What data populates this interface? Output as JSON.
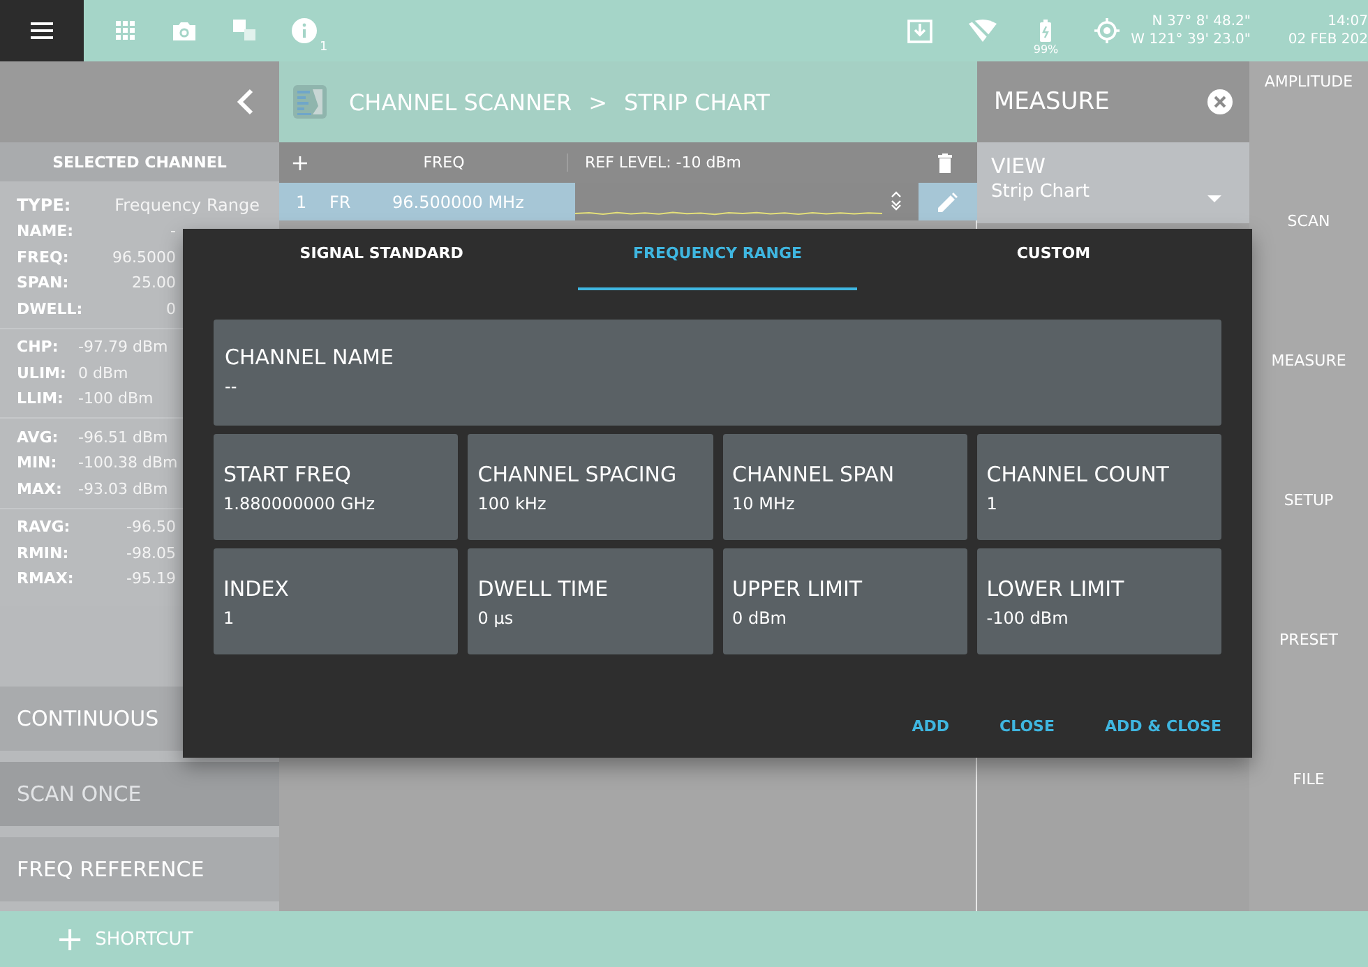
{
  "status_bar": {
    "info_count": "1",
    "battery": "99%",
    "latitude": "N 37° 8' 48.2\"",
    "longitude": "W 121° 39' 23.0\"",
    "time": "14:07",
    "date": "02 FEB 202"
  },
  "left_panel": {
    "header": "SELECTED CHANNEL",
    "groups": [
      {
        "rows": [
          {
            "label": "TYPE:",
            "value": "Frequency Range"
          },
          {
            "label": "NAME:",
            "value": "-"
          },
          {
            "label": "FREQ:",
            "value": "96.5000"
          },
          {
            "label": "SPAN:",
            "value": "25.00"
          },
          {
            "label": "DWELL:",
            "value": "0"
          }
        ]
      },
      {
        "rows": [
          {
            "label": "CHP:",
            "value": "-97.79 dBm"
          },
          {
            "label": "ULIM:",
            "value": "0 dBm"
          },
          {
            "label": "LLIM:",
            "value": "-100 dBm"
          }
        ]
      },
      {
        "rows": [
          {
            "label": "AVG:",
            "value": "-96.51 dBm"
          },
          {
            "label": "MIN:",
            "value": "-100.38 dBm"
          },
          {
            "label": "MAX:",
            "value": "-93.03 dBm"
          }
        ]
      },
      {
        "rows": [
          {
            "label": "RAVG:",
            "value": "-96.50"
          },
          {
            "label": "RMIN:",
            "value": "-98.05"
          },
          {
            "label": "RMAX:",
            "value": "-95.19"
          }
        ]
      }
    ],
    "buttons": [
      {
        "label": "CONTINUOUS",
        "disabled": false
      },
      {
        "label": "SCAN ONCE",
        "disabled": true
      },
      {
        "label": "FREQ REFERENCE",
        "disabled": false
      }
    ]
  },
  "breadcrumb": [
    "CHANNEL SCANNER",
    ">",
    "STRIP CHART"
  ],
  "table": {
    "add": "+",
    "columns": [
      "FREQ",
      "REF LEVEL: -10 dBm"
    ],
    "rows": [
      {
        "index": "1",
        "type": "FR",
        "freq": "96.500000 MHz",
        "selected": true
      }
    ]
  },
  "measure_panel": {
    "title": "MEASURE",
    "view": {
      "label": "VIEW",
      "value": "Strip Chart"
    }
  },
  "side_menu": [
    "AMPLITUDE",
    "SCAN",
    "MEASURE",
    "SETUP",
    "PRESET",
    "FILE"
  ],
  "dialog": {
    "tabs": [
      {
        "label": "SIGNAL STANDARD",
        "selected": false
      },
      {
        "label": "FREQUENCY RANGE",
        "selected": true
      },
      {
        "label": "CUSTOM",
        "selected": false
      }
    ],
    "name_field": {
      "label": "CHANNEL NAME",
      "value": "--"
    },
    "fields": [
      {
        "label": "START FREQ",
        "value": "1.880000000 GHz"
      },
      {
        "label": "CHANNEL SPACING",
        "value": "100 kHz"
      },
      {
        "label": "CHANNEL SPAN",
        "value": "10 MHz"
      },
      {
        "label": "CHANNEL COUNT",
        "value": "1"
      },
      {
        "label": "INDEX",
        "value": "1"
      },
      {
        "label": "DWELL TIME",
        "value": "0 µs"
      },
      {
        "label": "UPPER LIMIT",
        "value": "0 dBm"
      },
      {
        "label": "LOWER LIMIT",
        "value": "-100 dBm"
      }
    ],
    "buttons": [
      "ADD",
      "CLOSE",
      "ADD & CLOSE"
    ]
  },
  "shortcut": {
    "icon": "+",
    "label": "SHORTCUT"
  }
}
